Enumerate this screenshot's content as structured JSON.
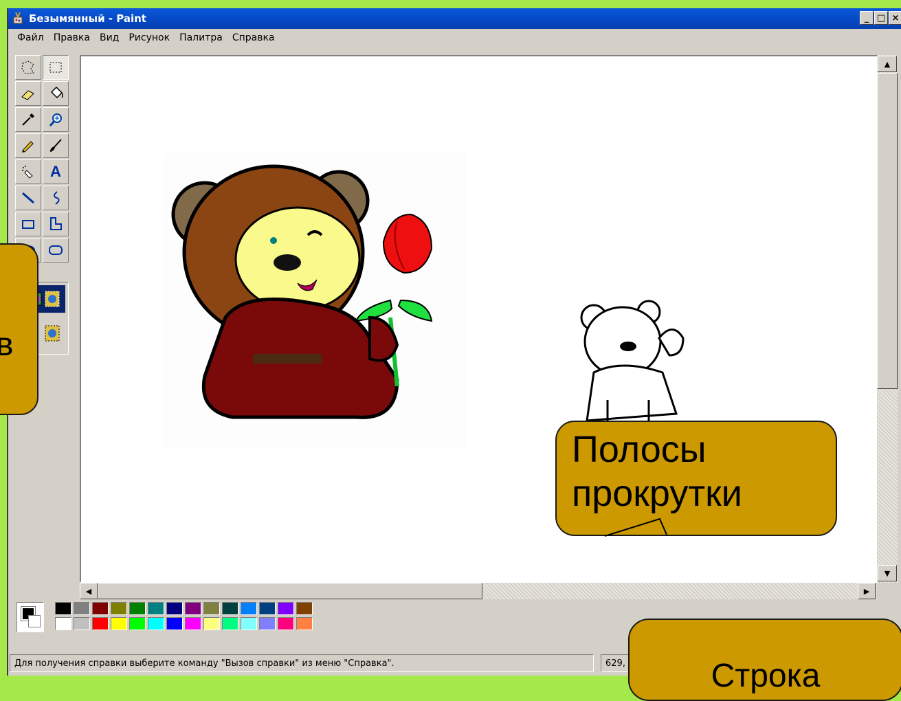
{
  "window": {
    "title": "Безымянный - Paint",
    "controls": [
      "_",
      "□",
      "×"
    ]
  },
  "menu": [
    "Файл",
    "Правка",
    "Вид",
    "Рисунок",
    "Палитра",
    "Справка"
  ],
  "tools": [
    {
      "name": "free-select-icon",
      "active": false
    },
    {
      "name": "rect-select-icon",
      "active": true
    },
    {
      "name": "eraser-icon",
      "active": false
    },
    {
      "name": "fill-icon",
      "active": false
    },
    {
      "name": "color-picker-icon",
      "active": false
    },
    {
      "name": "magnifier-icon",
      "active": false
    },
    {
      "name": "pencil-icon",
      "active": false
    },
    {
      "name": "brush-icon",
      "active": false
    },
    {
      "name": "airbrush-icon",
      "active": false
    },
    {
      "name": "text-icon",
      "active": false
    },
    {
      "name": "line-icon",
      "active": false
    },
    {
      "name": "curve-icon",
      "active": false
    },
    {
      "name": "rectangle-icon",
      "active": false
    },
    {
      "name": "polygon-icon",
      "active": false
    },
    {
      "name": "ellipse-icon",
      "active": false
    },
    {
      "name": "rounded-rect-icon",
      "active": false
    }
  ],
  "text_tool_glyph": "A",
  "palette": {
    "top": [
      "#000000",
      "#808080",
      "#800000",
      "#808000",
      "#008000",
      "#008080",
      "#000080",
      "#800080",
      "#808040",
      "#004040",
      "#0080ff",
      "#004080",
      "#8000ff",
      "#804000"
    ],
    "bottom": [
      "#ffffff",
      "#c0c0c0",
      "#ff0000",
      "#ffff00",
      "#00ff00",
      "#00ffff",
      "#0000ff",
      "#ff00ff",
      "#ffff80",
      "#00ff80",
      "#80ffff",
      "#8080ff",
      "#ff0080",
      "#ff8040"
    ]
  },
  "status": {
    "text": "Для получения справки выберите команду \"Вызов справки\" из меню \"Справка\".",
    "coords": "629,"
  },
  "callouts": {
    "left_partial": "в",
    "scrollbars": "Полосы прокрутки",
    "statusbar": "Строка"
  },
  "colors": {
    "slide_background": "#a5e84a",
    "callout_fill": "#cc9900",
    "titlebar": "#0647c4"
  }
}
